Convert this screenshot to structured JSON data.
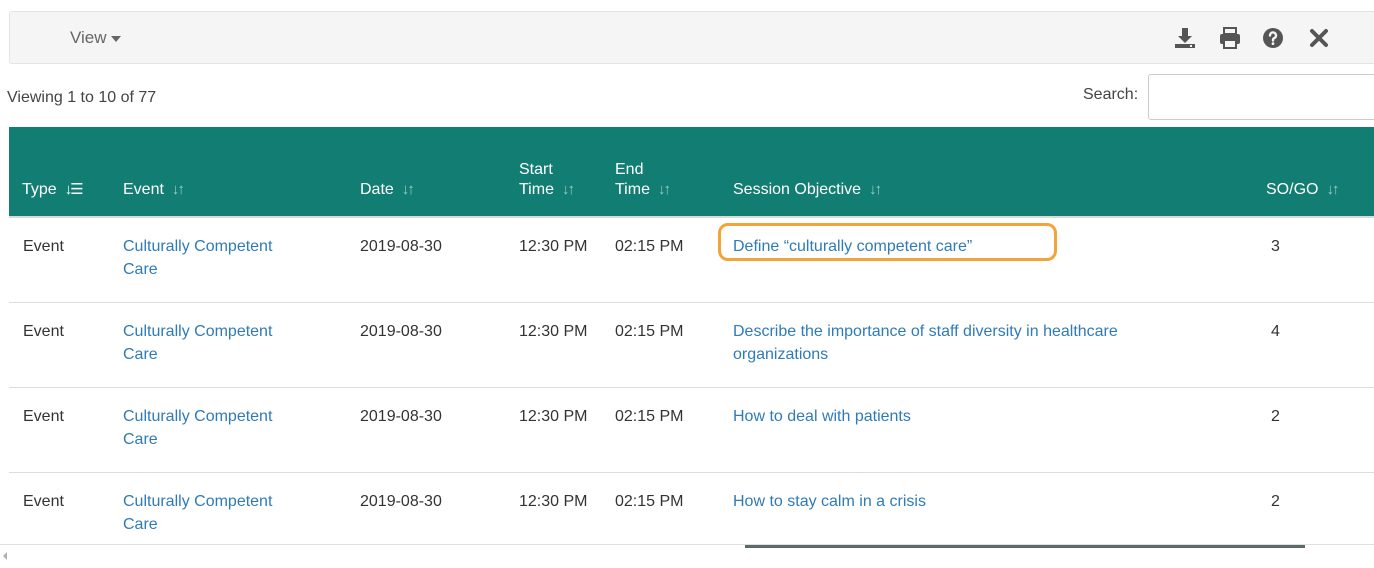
{
  "toolbar": {
    "view_label": "View",
    "icons": [
      "download-icon",
      "print-icon",
      "help-icon",
      "close-icon"
    ]
  },
  "info": {
    "viewing": "Viewing 1 to 10 of 77",
    "search_label": "Search:",
    "search_value": ""
  },
  "table": {
    "headers": {
      "type": "Type",
      "event": "Event",
      "date": "Date",
      "start_line1": "Start",
      "start_line2": "Time",
      "end_line1": "End",
      "end_line2": "Time",
      "objective": "Session Objective",
      "sogo": "SO/GO"
    },
    "rows": [
      {
        "type": "Event",
        "event_line1": "Culturally Competent",
        "event_line2": "Care",
        "date": "2019-08-30",
        "start": "12:30 PM",
        "end": "02:15 PM",
        "objective_line1": "Define “culturally competent care”",
        "objective_line2": "",
        "sogo": "3"
      },
      {
        "type": "Event",
        "event_line1": "Culturally Competent",
        "event_line2": "Care",
        "date": "2019-08-30",
        "start": "12:30 PM",
        "end": "02:15 PM",
        "objective_line1": "Describe the importance of staff diversity in healthcare",
        "objective_line2": "organizations",
        "sogo": "4"
      },
      {
        "type": "Event",
        "event_line1": "Culturally Competent",
        "event_line2": "Care",
        "date": "2019-08-30",
        "start": "12:30 PM",
        "end": "02:15 PM",
        "objective_line1": "How to deal with patients",
        "objective_line2": "",
        "sogo": "2"
      },
      {
        "type": "Event",
        "event_line1": "Culturally Competent",
        "event_line2": "Care",
        "date": "2019-08-30",
        "start": "12:30 PM",
        "end": "02:15 PM",
        "objective_line1": "How to stay calm in a crisis",
        "objective_line2": "",
        "sogo": "2"
      }
    ]
  },
  "colors": {
    "header_bg": "#127d72",
    "link": "#2f7bb8",
    "highlight": "#f2a33a"
  }
}
